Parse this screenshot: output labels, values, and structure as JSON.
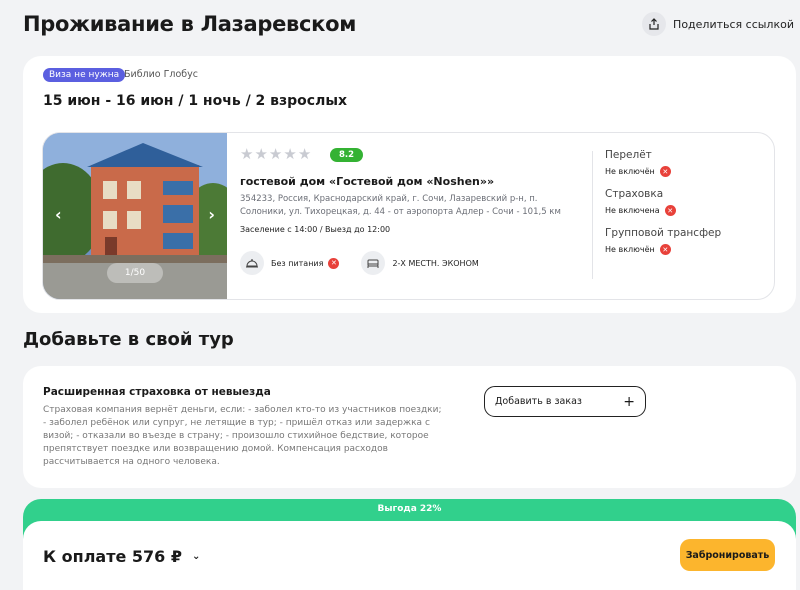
{
  "header": {
    "title": "Проживание в Лазаревском",
    "share_label": "Поделиться ссылкой"
  },
  "tour": {
    "visa_badge": "Виза не нужна",
    "operator": "Библио Глобус",
    "dates": "15 июн - 16 июн / 1 ночь / 2 взрослых"
  },
  "hotel": {
    "photo_counter": "1/50",
    "stars_filled": 0,
    "stars_total": 5,
    "rating": "8.2",
    "name": "гостевой дом «Гостевой дом «Noshen»»",
    "address": "354233, Россия, Краснодарский край, г. Сочи, Лазаревский р-н, п. Солоники, ул. Тихорецкая, д. 44 - от аэропорта Адлер - Сочи - 101,5 км",
    "checkin": "Заселение с 14:00 / Выезд до 12:00",
    "meal": "Без питания",
    "room": "2-Х МЕСТН. ЭКОНОМ"
  },
  "inclusions": [
    {
      "title": "Перелёт",
      "status": "Не включён"
    },
    {
      "title": "Страховка",
      "status": "Не включена"
    },
    {
      "title": "Групповой трансфер",
      "status": "Не включён"
    }
  ],
  "addons": {
    "section_title": "Добавьте в свой тур",
    "insurance_title": "Расширенная страховка от невыезда",
    "insurance_desc": "Страховая компания вернёт деньги, если: - заболел кто-то из участников поездки; - заболел ребёнок или супруг, не летящие в тур; - пришёл отказ или задержка с визой; - отказали во въезде в страну; - произошло стихийное бедствие, которое препятствует поездке или возвращению домой.  Компенсация расходов рассчитывается на одного человека.",
    "add_label": "Добавить в заказ",
    "add_icon": "+"
  },
  "payment": {
    "profit": "Выгода 22%",
    "label": "К оплате 576 ₽",
    "book_label": "Забронировать"
  },
  "colors": {
    "accent_green": "#31d08c",
    "visa_badge": "#5b5fe0",
    "rating_green": "#34b233",
    "book_yellow": "#fcb52d",
    "error_red": "#e8413a"
  }
}
